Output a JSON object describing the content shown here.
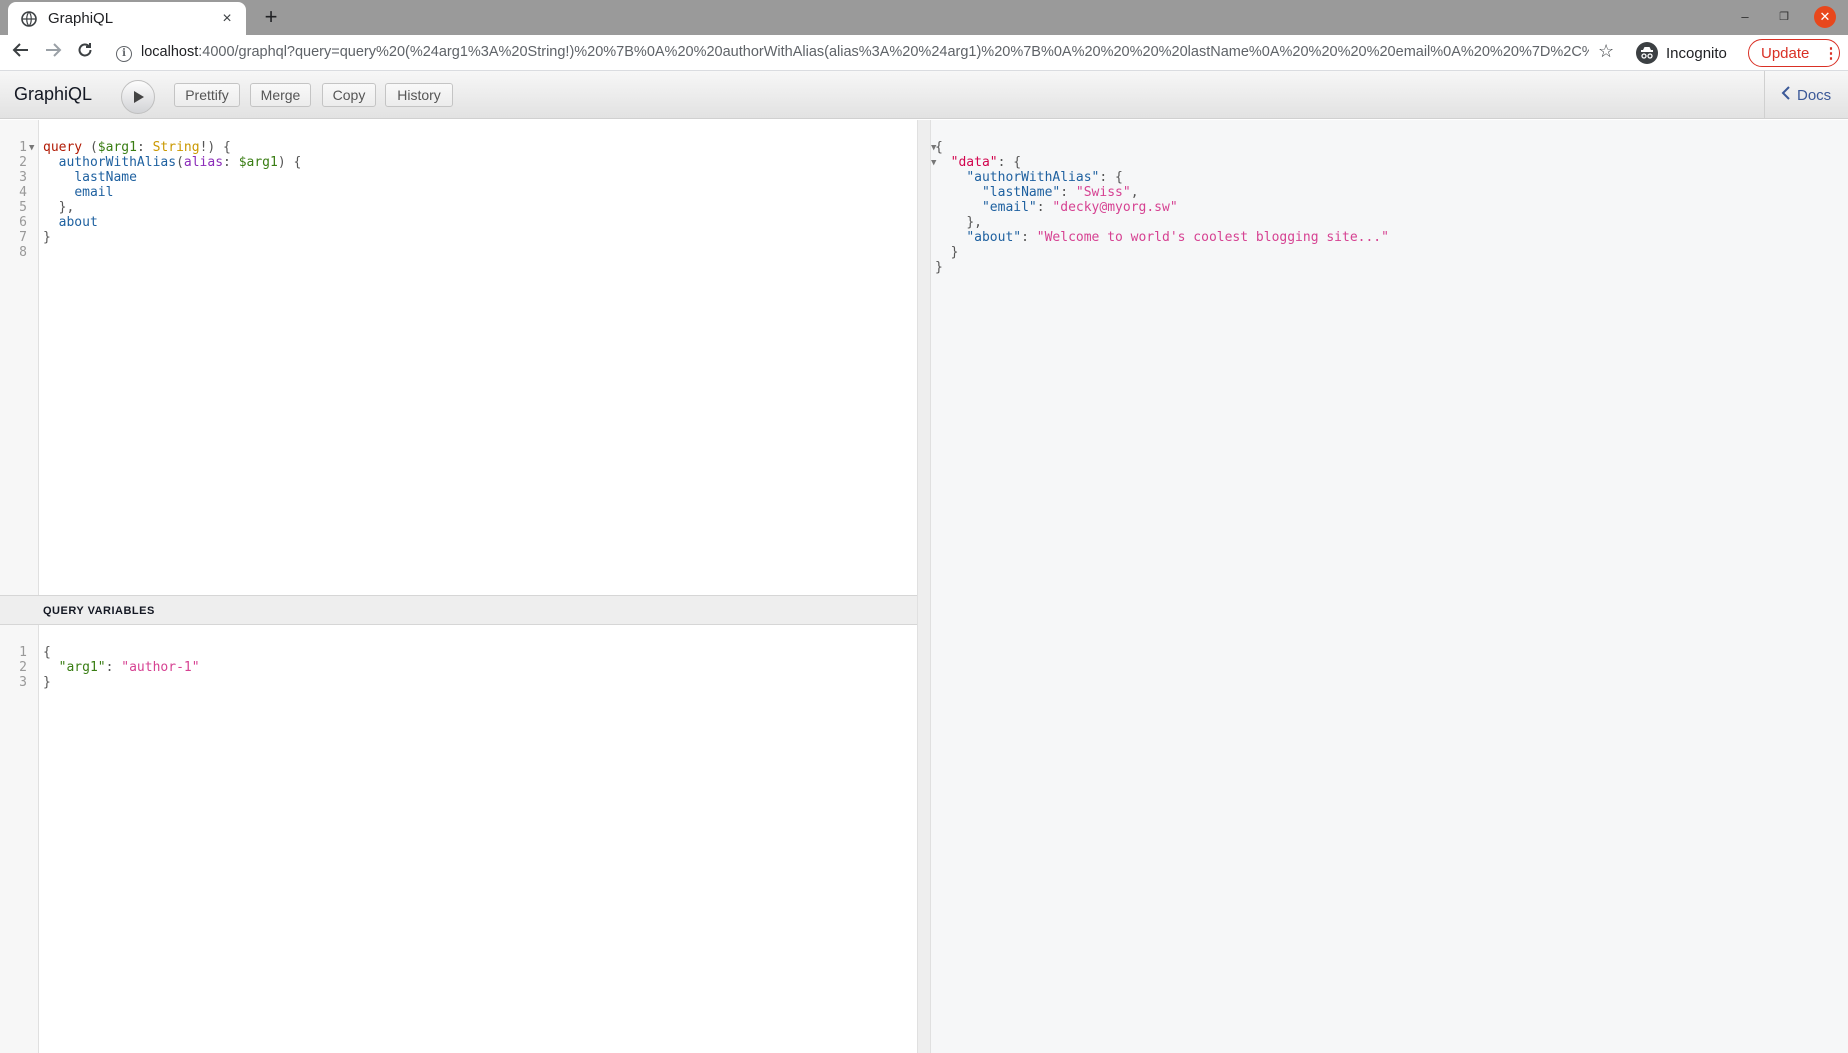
{
  "browser": {
    "tab_title": "GraphiQL",
    "tab_close": "×",
    "new_tab": "+",
    "url_host": "localhost",
    "url_rest": ":4000/graphql?query=query%20(%24arg1%3A%20String!)%20%7B%0A%20%20authorWithAlias(alias%3A%20%24arg1)%20%7B%0A%20%20%20%20lastName%0A%20%20%20%20email%0A%20%20%7D%2C%0A...",
    "incognito_label": "Incognito",
    "update_label": "Update"
  },
  "graphiql": {
    "title": "GraphiQL",
    "buttons": {
      "prettify": "Prettify",
      "merge": "Merge",
      "copy": "Copy",
      "history": "History",
      "docs": "Docs"
    },
    "query_line_numbers": [
      "1",
      "2",
      "3",
      "4",
      "5",
      "6",
      "7",
      "8"
    ],
    "query": {
      "l1_kw": "query",
      "l1_open": " (",
      "l1_var": "$arg1",
      "l1_colon": ": ",
      "l1_type": "String",
      "l1_close": "!) {",
      "l2_field": "authorWithAlias",
      "l2_paren": "(",
      "l2_arg": "alias",
      "l2_colon": ": ",
      "l2_var": "$arg1",
      "l2_close": ") {",
      "l3": "lastName",
      "l4": "email",
      "l5": "},",
      "l6": "about",
      "l7": "}"
    },
    "variables_title": "QUERY VARIABLES",
    "variables_line_numbers": [
      "1",
      "2",
      "3"
    ],
    "variables": {
      "open": "{",
      "key": "\"arg1\"",
      "colon": ": ",
      "value": "\"author-1\"",
      "close": "}"
    },
    "result": {
      "l1": "{",
      "l2_key": "\"data\"",
      "l2_rest": ": {",
      "l3_key": "\"authorWithAlias\"",
      "l3_rest": ": {",
      "l4_key": "\"lastName\"",
      "l4_colon": ": ",
      "l4_val": "\"Swiss\"",
      "l4_comma": ",",
      "l5_key": "\"email\"",
      "l5_colon": ": ",
      "l5_val": "\"decky@myorg.sw\"",
      "l6": "},",
      "l7_key": "\"about\"",
      "l7_colon": ": ",
      "l7_val": "\"Welcome to world's coolest blogging site...\"",
      "l8": "}",
      "l9": "}"
    }
  },
  "colors": {
    "update_red": "#d93025",
    "docs_blue": "#3b5998",
    "string_pink": "#d64292"
  }
}
